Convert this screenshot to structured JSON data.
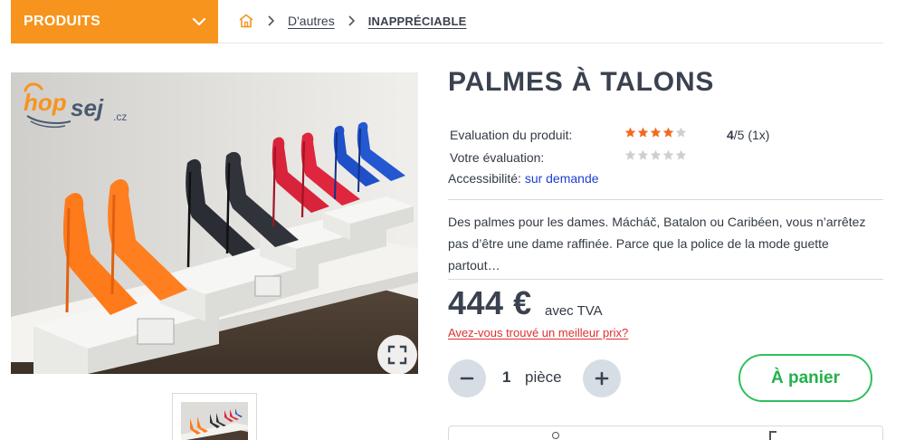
{
  "category_button": {
    "label": "PRODUITS"
  },
  "breadcrumb": {
    "items": [
      "D'autres",
      "INAPPRÉCIABLE"
    ]
  },
  "image": {
    "logo_text": "hop",
    "logo_text_2": "sej",
    "logo_suffix": ".cz"
  },
  "product": {
    "title": "PALMES À TALONS",
    "rating_label": "Evaluation du produit:",
    "rating_value": 4,
    "rating_max": 5,
    "rating_score": "4",
    "rating_suffix": "/5 (1x)",
    "your_rating_label": "Votre évaluation:",
    "your_rating_value": 0,
    "availability_label": "Accessibilité:",
    "availability_value": "sur demande",
    "description": "Des palmes pour les dames. Mácháč, Batalon ou Caribéen, vous n’arrêtez pas d’être une dame raffinée. Parce que la police de la mode guette partout…",
    "price": "444 €",
    "vat_label": "avec TVA",
    "better_price_link": "Avez-vous trouvé un meilleur prix?",
    "quantity": "1",
    "quantity_unit": "pièce",
    "add_to_cart": "À panier"
  },
  "colors": {
    "brand_orange": "#f7941d",
    "cart_green": "#22b14c",
    "star_filled": "#f26b21",
    "star_empty": "#cfcfcf",
    "link_blue": "#1d3fd0",
    "alert_red": "#e03030"
  },
  "icons": {
    "category_chevron": "chevron-down-icon",
    "home": "home-icon",
    "breadcrumb_separator": "chevron-right-icon",
    "zoom": "fullscreen-icon",
    "minus": "minus-icon",
    "plus": "plus-icon"
  }
}
